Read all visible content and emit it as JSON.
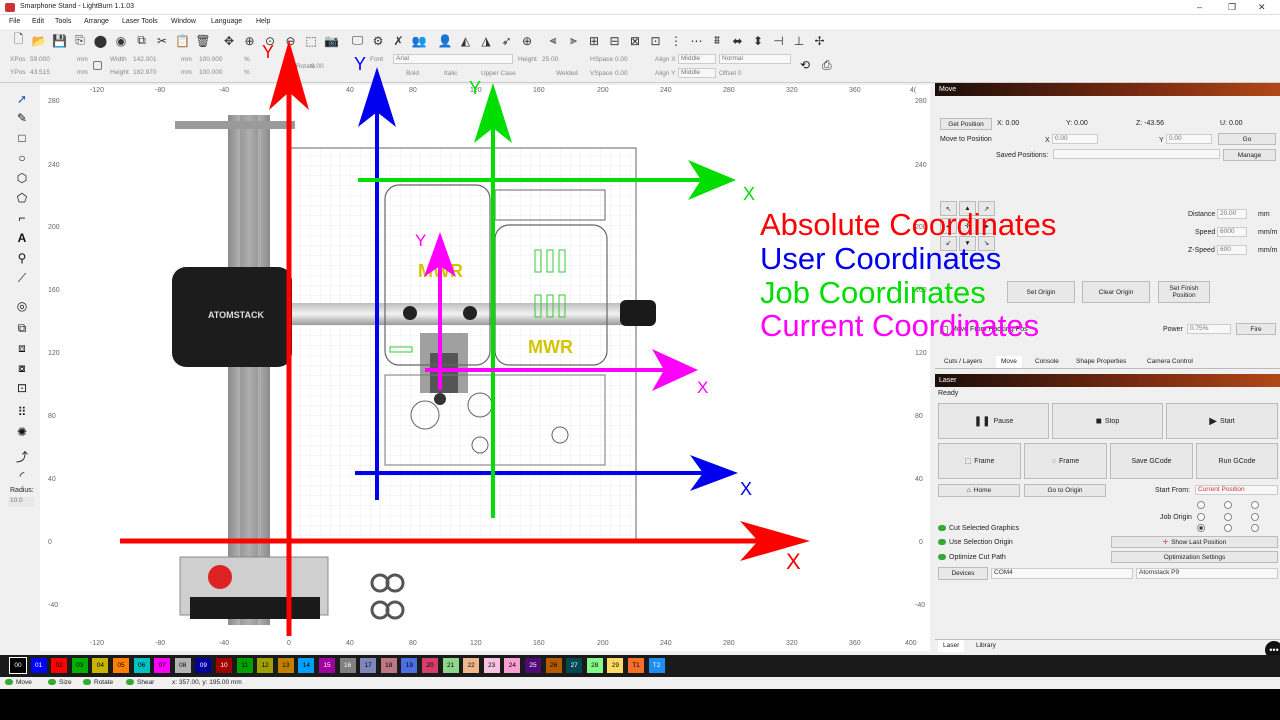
{
  "window": {
    "title": "Smarphone Stand - LightBurn 1.1.03"
  },
  "menu": [
    "File",
    "Edit",
    "Tools",
    "Arrange",
    "Laser Tools",
    "Window",
    "Language",
    "Help"
  ],
  "toolbar_icons": [
    "new-file",
    "open-folder",
    "save",
    "save-as",
    "import",
    "export",
    "copy",
    "cut",
    "paste",
    "delete",
    "move",
    "zoom-in",
    "zoom-fit",
    "zoom-out",
    "select-rect",
    "camera",
    "monitor",
    "settings",
    "tools",
    "users",
    "user",
    "mirror-h",
    "mirror-v",
    "send",
    "target",
    "align-left",
    "align-center",
    "align-right",
    "align-top",
    "align-middle",
    "align-bottom",
    "dist-h",
    "dist-v",
    "dist-both",
    "make-same-w",
    "make-same-h",
    "move-left",
    "move-down",
    "move-cross"
  ],
  "props": {
    "xpos_label": "XPos",
    "xpos": "59.000",
    "ypos_label": "YPos",
    "ypos": "43.515",
    "unit": "mm",
    "width_label": "Width",
    "width": "142.001",
    "height_label": "Height",
    "height": "182.970",
    "scale_w": "100.000",
    "scale_h": "100.000",
    "pct": "%",
    "font_label": "Font",
    "font": "Arial",
    "height2_label": "Height",
    "height2": "25.00",
    "hspace_label": "HSpace",
    "hspace": "0.00",
    "vspace_label": "VSpace",
    "vspace": "0.00",
    "alignx_label": "Align X",
    "alignx": "Middle",
    "aligny_label": "Align Y",
    "aligny": "Middle",
    "normal": "Normal",
    "offset_label": "Offset",
    "offset": "0",
    "rotate_label": "Rotate",
    "rotate": "0.00",
    "bold": "Bold",
    "italic": "Italic",
    "upper": "Upper Case",
    "welded": "Welded"
  },
  "radius": {
    "label": "Radius:",
    "value": "10.0"
  },
  "rulers": {
    "top": [
      "-120",
      "-80",
      "-40",
      "0",
      "40",
      "80",
      "120",
      "160",
      "200",
      "240",
      "280",
      "320",
      "360",
      "4("
    ],
    "left": [
      "280",
      "240",
      "200",
      "160",
      "120",
      "80",
      "40",
      "0",
      "-40"
    ],
    "bottom": [
      "-120",
      "-80",
      "-40",
      "0",
      "40",
      "80",
      "120",
      "160",
      "200",
      "240",
      "280",
      "320",
      "360",
      "400"
    ],
    "right": [
      "280",
      "240",
      "200",
      "160",
      "120",
      "80",
      "40",
      "0",
      "-40"
    ]
  },
  "overlay": {
    "absolute": "Absolute Coordinates",
    "user": "User Coordinates",
    "job": "Job Coordinates",
    "current": "Current Coordinates",
    "x": "X",
    "y": "Y",
    "brand": "ATOMSTACK",
    "mwr": "MWR",
    "colors": {
      "red": "#ff0000",
      "blue": "#0000ee",
      "green": "#00dd00",
      "magenta": "#ff00ff"
    }
  },
  "move": {
    "title": "Move",
    "get_position": "Get Position",
    "x": "X: 0.00",
    "y": "Y: 0.00",
    "z": "Z: -43.56",
    "u": "U: 0.00",
    "move_to": "Move to Position",
    "x_label": "X",
    "x_val": "0.00",
    "y_label": "Y",
    "y_val": "0.00",
    "go": "Go",
    "saved": "Saved Positions:",
    "manage": "Manage",
    "distance_label": "Distance",
    "distance": "20.00",
    "mm": "mm",
    "speed_label": "Speed",
    "speed": "6000",
    "mmm": "mm/m",
    "zspeed_label": "Z-Speed",
    "zspeed": "600",
    "set_origin": "Set Origin",
    "clear_origin": "Clear Origin",
    "set_finish": "Set Finish Position",
    "move_from": "Move From Hacking Pos",
    "power_label": "Power",
    "power": "0.75%",
    "fire": "Fire"
  },
  "tabs": [
    "Cuts / Layers",
    "Move",
    "Console",
    "Shape Properties",
    "Camera Control"
  ],
  "laser": {
    "title": "Laser",
    "status": "Ready",
    "pause": "Pause",
    "stop": "Stop",
    "start": "Start",
    "frame1": "Frame",
    "frame2": "Frame",
    "save_gcode": "Save GCode",
    "run_gcode": "Run GCode",
    "home": "Home",
    "go_origin": "Go to Origin",
    "start_from_label": "Start From:",
    "start_from": "Current Position",
    "job_origin": "Job Origin",
    "cut_selected": "Cut Selected Graphics",
    "use_selection": "Use Selection Origin",
    "optimize": "Optimize Cut Path",
    "show_last": "Show Last Position",
    "opt_settings": "Optimization Settings",
    "devices": "Devices",
    "port": "COM4",
    "device": "Atomstack P9"
  },
  "bottom_tabs": [
    "Laser",
    "Library"
  ],
  "palette": [
    {
      "l": "00",
      "c": "#000000"
    },
    {
      "l": "01",
      "c": "#0000ff"
    },
    {
      "l": "02",
      "c": "#ff0000"
    },
    {
      "l": "03",
      "c": "#00b000"
    },
    {
      "l": "04",
      "c": "#c8b400"
    },
    {
      "l": "05",
      "c": "#ff8000"
    },
    {
      "l": "06",
      "c": "#00c0c0"
    },
    {
      "l": "07",
      "c": "#ff00ff"
    },
    {
      "l": "08",
      "c": "#b4b4b4"
    },
    {
      "l": "09",
      "c": "#0000a0"
    },
    {
      "l": "10",
      "c": "#a00000"
    },
    {
      "l": "11",
      "c": "#00a000"
    },
    {
      "l": "12",
      "c": "#a0a000"
    },
    {
      "l": "13",
      "c": "#c08000"
    },
    {
      "l": "14",
      "c": "#00a0ff"
    },
    {
      "l": "15",
      "c": "#a000a0"
    },
    {
      "l": "16",
      "c": "#808080"
    },
    {
      "l": "17",
      "c": "#7d87b9"
    },
    {
      "l": "18",
      "c": "#bb7784"
    },
    {
      "l": "19",
      "c": "#4a6fe3"
    },
    {
      "l": "20",
      "c": "#d33f6a"
    },
    {
      "l": "21",
      "c": "#8cd78c"
    },
    {
      "l": "22",
      "c": "#f0b98d"
    },
    {
      "l": "23",
      "c": "#f6c4e1"
    },
    {
      "l": "24",
      "c": "#fa9ed4"
    },
    {
      "l": "25",
      "c": "#500a78"
    },
    {
      "l": "26",
      "c": "#b45a00"
    },
    {
      "l": "27",
      "c": "#004754"
    },
    {
      "l": "28",
      "c": "#86fa88"
    },
    {
      "l": "29",
      "c": "#ffdb66"
    },
    {
      "l": "T1",
      "c": "#f36f2a"
    },
    {
      "l": "T2",
      "c": "#1e8ef2"
    }
  ],
  "status": {
    "move": "Move",
    "size": "Size",
    "rotate": "Rotate",
    "shear": "Shear",
    "coords": "x: 357.00, y: 195.00 mm"
  }
}
